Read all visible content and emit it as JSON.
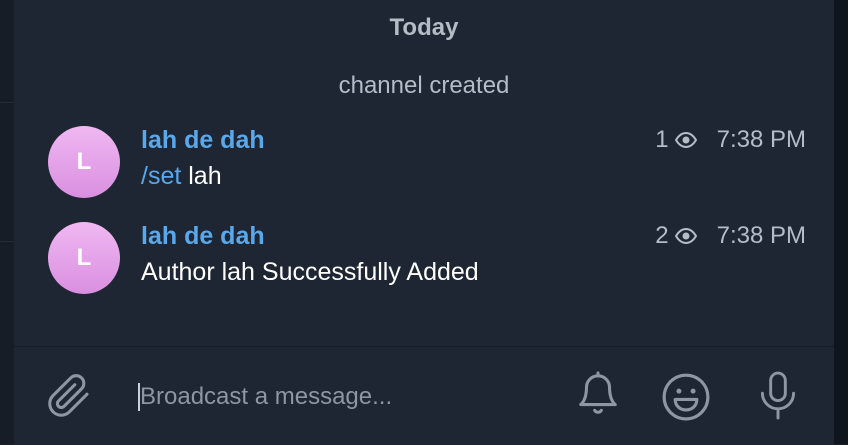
{
  "date_separator": "Today",
  "service_message": "channel created",
  "messages": [
    {
      "avatar_initial": "L",
      "author": "lah de dah",
      "command": "/set",
      "text": " lah",
      "views": "1",
      "time": "7:38 PM"
    },
    {
      "avatar_initial": "L",
      "author": "lah de dah",
      "command": "",
      "text": "Author lah Successfully Added",
      "views": "2",
      "time": "7:38 PM"
    }
  ],
  "composer": {
    "placeholder": "Broadcast a message...",
    "attach_icon": "paperclip-icon",
    "silent_icon": "bell-icon",
    "emoji_icon": "smiley-icon",
    "voice_icon": "microphone-icon"
  },
  "colors": {
    "accent": "#5aa8ec",
    "avatar": "#e4a0e8",
    "background": "#1d2632",
    "secondary_text": "#b4bcc6"
  }
}
